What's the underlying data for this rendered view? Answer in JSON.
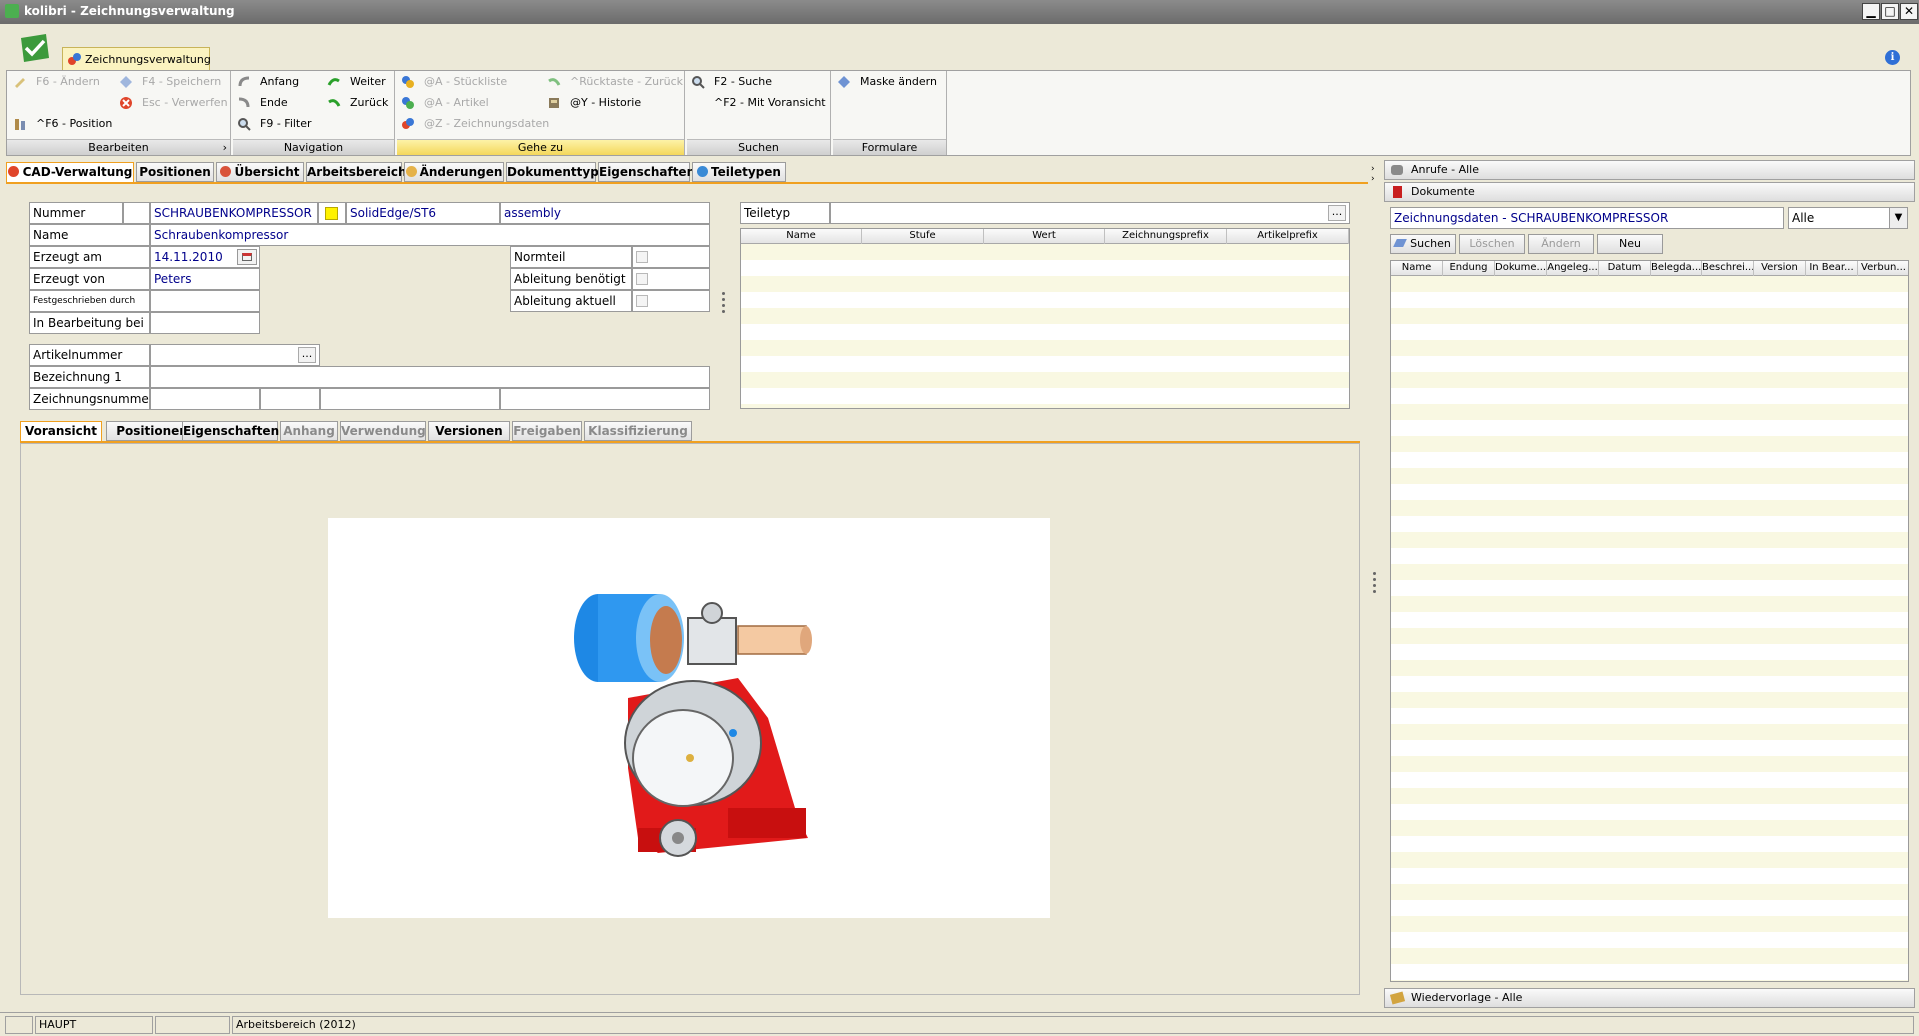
{
  "window": {
    "title": "kolibri - Zeichnungsverwaltung"
  },
  "ribbon": {
    "tab_label": "Zeichnungsverwaltung",
    "groups": {
      "bearbeiten": {
        "label": "Bearbeiten",
        "aendern": "F6 - Ändern",
        "speichern": "F4 - Speichern",
        "verwerfen": "Esc - Verwerfen",
        "position": "^F6 - Position"
      },
      "navigation": {
        "label": "Navigation",
        "anfang": "Anfang",
        "weiter": "Weiter",
        "ende": "Ende",
        "zurueck": "Zurück",
        "filter": "F9 - Filter"
      },
      "gehezu": {
        "label": "Gehe zu",
        "stueckliste": "@A - Stückliste",
        "ruecktaste": "^Rücktaste - Zurück",
        "artikel": "@A - Artikel",
        "historie": "@Y - Historie",
        "zeichnungsdaten": "@Z - Zeichnungsdaten"
      },
      "suchen": {
        "label": "Suchen",
        "suche": "F2 - Suche",
        "voransicht": "^F2 - Mit Voransicht"
      },
      "formulare": {
        "label": "Formulare",
        "maske": "Maske ändern"
      }
    }
  },
  "main_tabs": [
    "CAD-Verwaltung",
    "Positionen",
    "Übersicht",
    "Arbeitsbereich",
    "Änderungen",
    "Dokumenttyp",
    "Eigenschaften",
    "Teiletypen"
  ],
  "form": {
    "nummer_label": "Nummer",
    "nummer": "SCHRAUBENKOMPRESSOR",
    "cad_system": "SolidEdge/ST6",
    "typ": "assembly",
    "name_label": "Name",
    "name": "Schraubenkompressor",
    "erzeugt_am_label": "Erzeugt am",
    "erzeugt_am": "14.11.2010",
    "erzeugt_von_label": "Erzeugt von",
    "erzeugt_von": "Peters",
    "festgeschrieben_label": "Festgeschrieben durch",
    "in_bearbeitung_label": "In Bearbeitung bei",
    "normteil_label": "Normteil",
    "ableitung_benoetigt_label": "Ableitung benötigt",
    "ableitung_aktuell_label": "Ableitung aktuell",
    "artikelnummer_label": "Artikelnummer",
    "bezeichnung1_label": "Bezeichnung 1",
    "zeichnungsnummer_label": "Zeichnungsnummer",
    "teiletyp_label": "Teiletyp",
    "ellipsis": "..."
  },
  "teiletyp_grid": {
    "columns": [
      "Name",
      "Stufe",
      "Wert",
      "Zeichnungsprefix",
      "Artikelprefix"
    ]
  },
  "sub_tabs": [
    "Voransicht",
    "Positionen",
    "Eigenschaften",
    "Anhang",
    "Verwendung",
    "Versionen",
    "Freigaben",
    "Klassifizierung"
  ],
  "right_panel": {
    "anrufe": "Anrufe - Alle",
    "dokumente": "Dokumente",
    "header_text": "Zeichnungsdaten - SCHRAUBENKOMPRESSOR",
    "filter_value": "Alle",
    "buttons": {
      "suchen": "Suchen",
      "loeschen": "Löschen",
      "aendern": "Ändern",
      "neu": "Neu"
    },
    "columns": [
      "Name",
      "Endung",
      "Dokume...",
      "Angeleg...",
      "Datum",
      "Belegda...",
      "Beschrei...",
      "Version",
      "In Bear...",
      "Verbun..."
    ],
    "wiedervorlage": "Wiedervorlage - Alle"
  },
  "statusbar": {
    "mode": "HAUPT",
    "arbeitsbereich": "Arbeitsbereich (2012)"
  },
  "colors": {
    "accent_orange": "#f0a020",
    "value_blue": "#00008b",
    "ribbon_active": "#f4d75b"
  }
}
